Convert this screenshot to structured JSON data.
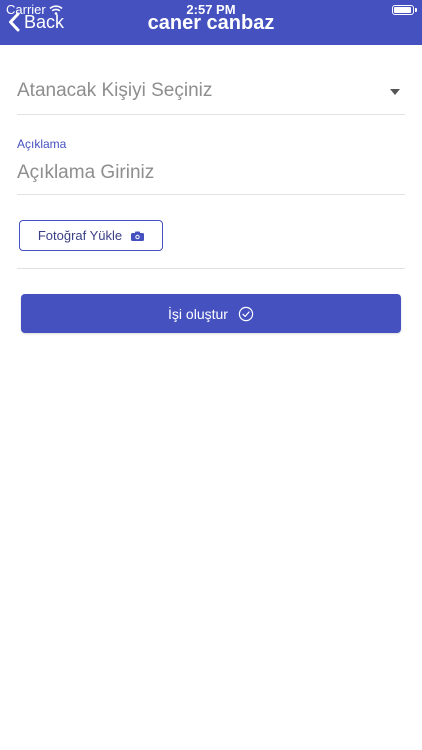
{
  "status_bar": {
    "carrier": "Carrier",
    "time": "2:57 PM",
    "battery_level": 0.95
  },
  "nav": {
    "back_label": "Back",
    "title": "caner canbaz"
  },
  "form": {
    "assignee_placeholder": "Atanacak Kişiyi Seçiniz",
    "description_label": "Açıklama",
    "description_placeholder": "Açıklama Giriniz",
    "description_value": "",
    "photo_button_label": "Fotoğraf Yükle",
    "submit_label": "İşi oluştur"
  },
  "colors": {
    "accent": "#4451bf",
    "divider": "#e2e2e2",
    "placeholder": "#8e8e8e"
  },
  "icons": {
    "back": "chevron-left-icon",
    "wifi": "wifi-icon",
    "battery": "battery-icon",
    "dropdown": "caret-down-icon",
    "camera": "camera-icon",
    "check": "check-circle-icon"
  }
}
